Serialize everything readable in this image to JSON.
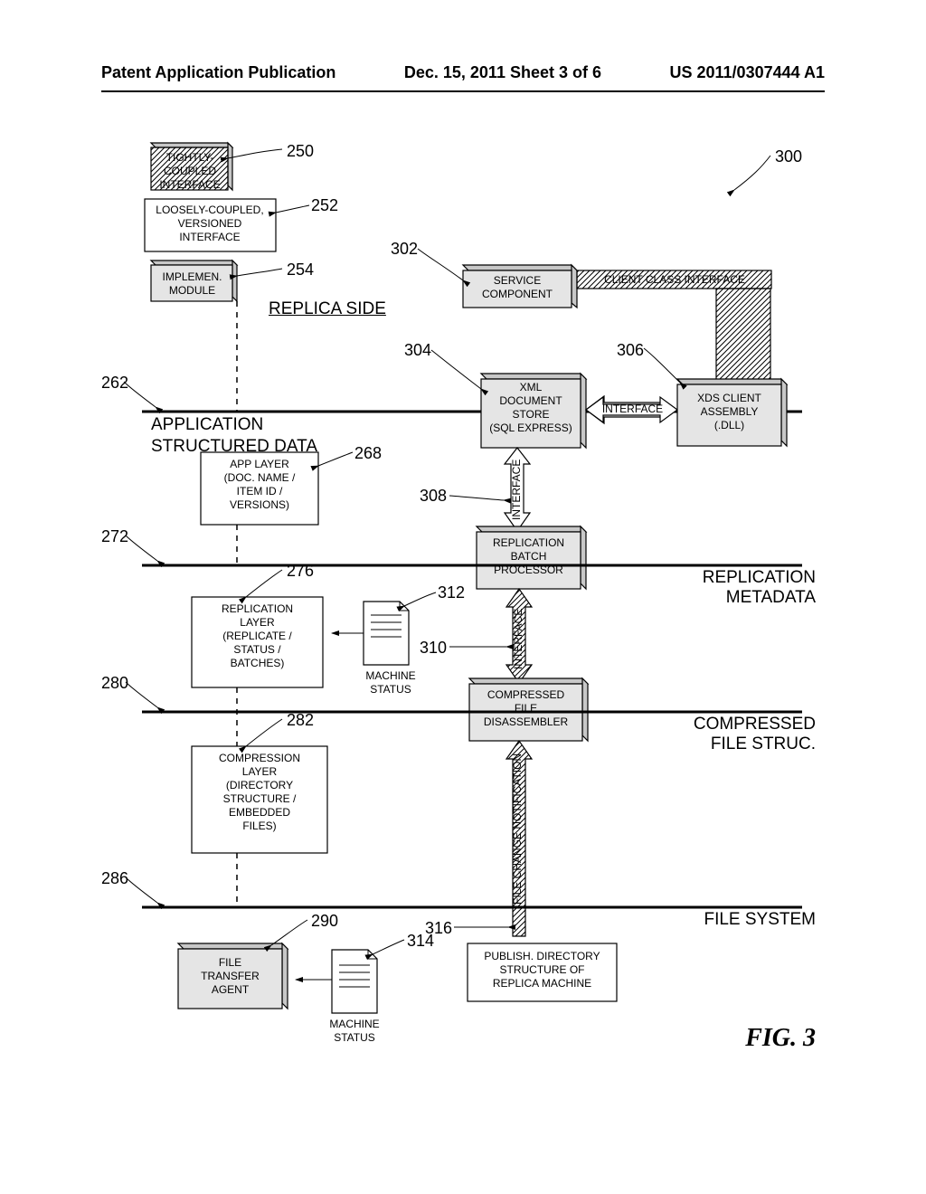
{
  "header": {
    "left": "Patent Application Publication",
    "center": "Dec. 15, 2011  Sheet 3 of 6",
    "right": "US 2011/0307444 A1"
  },
  "figure_caption": "FIG. 3",
  "layers": {
    "app_struct_data": "APPLICATION\nSTRUCTURED DATA",
    "replication_metadata": "REPLICATION\nMETADATA",
    "compressed_file_struc": "COMPRESSED\nFILE STRUC.",
    "file_system": "FILE SYSTEM",
    "replica_side": "REPLICA SIDE"
  },
  "blocks": {
    "tightly_coupled_interface": "TIGHTLY-\nCOUPLED\nINTERFACE",
    "loosely_coupled_versioned_interface": "LOOSELY-COUPLED,\nVERSIONED\nINTERFACE",
    "implemen_module": "IMPLEMEN.\nMODULE",
    "service_component": "SERVICE\nCOMPONENT",
    "client_class_interface": "CLIENT CLASS INTERFACE",
    "xml_document_store": "XML\nDOCUMENT\nSTORE\n(SQL EXPRESS)",
    "xds_client_assembly": "XDS CLIENT\nASSEMBLY\n(.DLL)",
    "interface_lbl": "INTERFACE",
    "replication_batch_processor": "REPLICATION\nBATCH\nPROCESSOR",
    "compressed_file_disassembler": "COMPRESSED\nFILE\nDISASSEMBLER",
    "app_layer": "APP LAYER\n(DOC. NAME /\nITEM ID /\nVERSIONS)",
    "replication_layer": "REPLICATION\nLAYER\n(REPLICATE /\nSTATUS /\nBATCHES)",
    "compression_layer": "COMPRESSION\nLAYER\n(DIRECTORY\nSTRUCTURE /\nEMBEDDED\nFILES)",
    "file_transfer_agent": "FILE\nTRANSFER\nAGENT",
    "machine_status": "MACHINE\nSTATUS",
    "publish_directory": "PUBLISH. DIRECTORY\nSTRUCTURE OF\nREPLICA MACHINE",
    "file_change_notification": "FILE CHANGE NOTIFICATION"
  },
  "refs": {
    "r250": "250",
    "r252": "252",
    "r254": "254",
    "r262": "262",
    "r268": "268",
    "r272": "272",
    "r276": "276",
    "r280": "280",
    "r282": "282",
    "r286": "286",
    "r290": "290",
    "r300": "300",
    "r302": "302",
    "r304": "304",
    "r306": "306",
    "r308": "308",
    "r310": "310",
    "r312": "312",
    "r314": "314",
    "r316": "316"
  }
}
